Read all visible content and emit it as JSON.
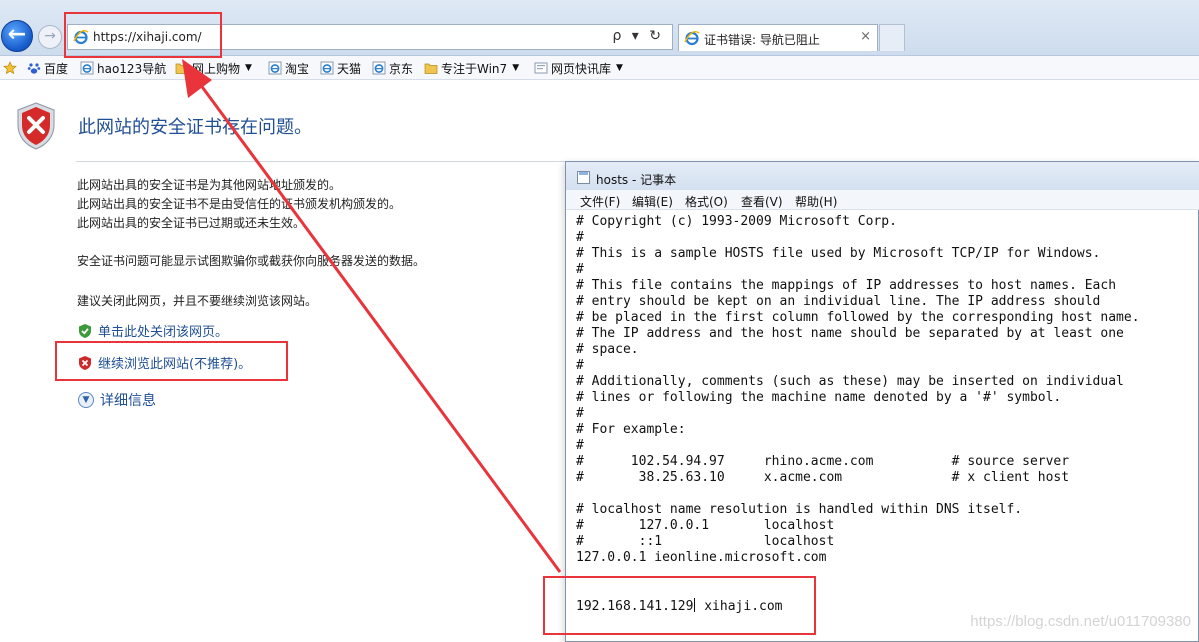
{
  "browser": {
    "address_url": "https://xihaji.com/",
    "tab_title": "证书错误: 导航已阻止",
    "tab_close": "×",
    "address_tools": "ρ ▾ ↻"
  },
  "favorites": [
    {
      "label": "百度",
      "icon": "paw-icon"
    },
    {
      "label": "hao123导航",
      "icon": "ie-page-icon"
    },
    {
      "label": "网上购物",
      "icon": "folder-icon",
      "dropdown": true
    },
    {
      "label": "淘宝",
      "icon": "ie-page-icon"
    },
    {
      "label": "天猫",
      "icon": "ie-page-icon"
    },
    {
      "label": "京东",
      "icon": "ie-page-icon"
    },
    {
      "label": "专注于Win7",
      "icon": "folder-icon",
      "dropdown": true
    },
    {
      "label": "网页快讯库",
      "icon": "webslice-icon",
      "dropdown": true
    }
  ],
  "cert_page": {
    "title": "此网站的安全证书存在问题。",
    "reasons": [
      "此网站出具的安全证书是为其他网站地址颁发的。",
      "此网站出具的安全证书不是由受信任的证书颁发机构颁发的。",
      "此网站出具的安全证书已过期或还未生效。"
    ],
    "warning": "安全证书问题可能显示试图欺骗你或截获你向服务器发送的数据。",
    "recommend": "建议关闭此网页，并且不要继续浏览该网站。",
    "close_link": "单击此处关闭该网页。",
    "continue_link": "继续浏览此网站(不推荐)。",
    "details_link": "详细信息"
  },
  "notepad": {
    "title": "hosts - 记事本",
    "menu": [
      "文件(F)",
      "编辑(E)",
      "格式(O)",
      "查看(V)",
      "帮助(H)"
    ],
    "lines": [
      "# Copyright (c) 1993-2009 Microsoft Corp.",
      "#",
      "# This is a sample HOSTS file used by Microsoft TCP/IP for Windows.",
      "#",
      "# This file contains the mappings of IP addresses to host names. Each",
      "# entry should be kept on an individual line. The IP address should",
      "# be placed in the first column followed by the corresponding host name.",
      "# The IP address and the host name should be separated by at least one",
      "# space.",
      "#",
      "# Additionally, comments (such as these) may be inserted on individual",
      "# lines or following the machine name denoted by a '#' symbol.",
      "#",
      "# For example:",
      "#",
      "#      102.54.94.97     rhino.acme.com          # source server",
      "#       38.25.63.10     x.acme.com              # x client host",
      "",
      "# localhost name resolution is handled within DNS itself.",
      "#       127.0.0.1       localhost",
      "#       ::1             localhost",
      "127.0.0.1 ieonline.microsoft.com",
      "",
      ""
    ],
    "edited_ip": "192.168.141.129",
    "edited_host": " xihaji.com"
  },
  "watermark": "https://blog.csdn.net/u011709380",
  "colors": {
    "annotation_red": "#e8343a",
    "link_blue": "#1f4f94"
  }
}
